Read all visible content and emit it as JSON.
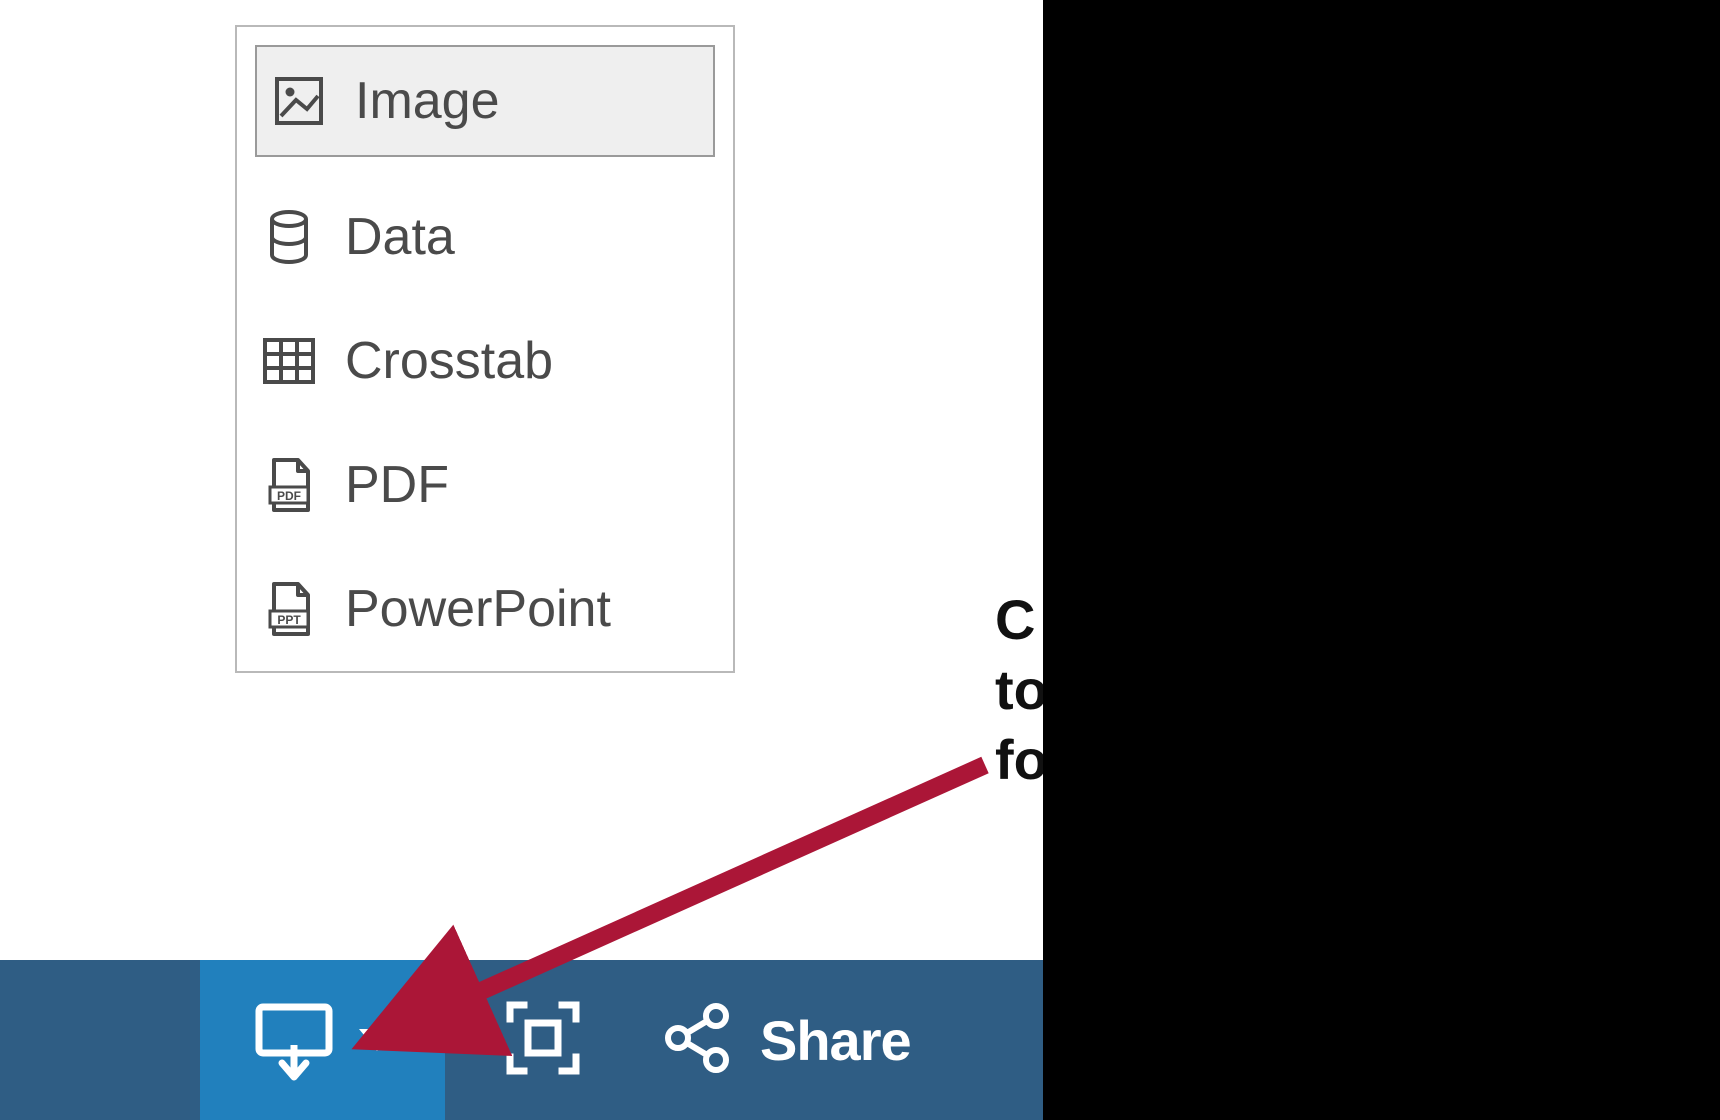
{
  "download_menu": {
    "items": [
      {
        "label": "Image",
        "icon": "image-icon",
        "selected": true
      },
      {
        "label": "Data",
        "icon": "data-icon",
        "selected": false
      },
      {
        "label": "Crosstab",
        "icon": "crosstab-icon",
        "selected": false
      },
      {
        "label": "PDF",
        "icon": "pdf-icon",
        "selected": false
      },
      {
        "label": "PowerPoint",
        "icon": "powerpoint-icon",
        "selected": false
      }
    ]
  },
  "toolbar": {
    "share_label": "Share"
  },
  "annotation": {
    "line1": "C",
    "line2": "to",
    "line3": "fo"
  },
  "colors": {
    "toolbar_bg": "#2f5d84",
    "download_active_bg": "#2180bd",
    "arrow": "#ab1637"
  }
}
